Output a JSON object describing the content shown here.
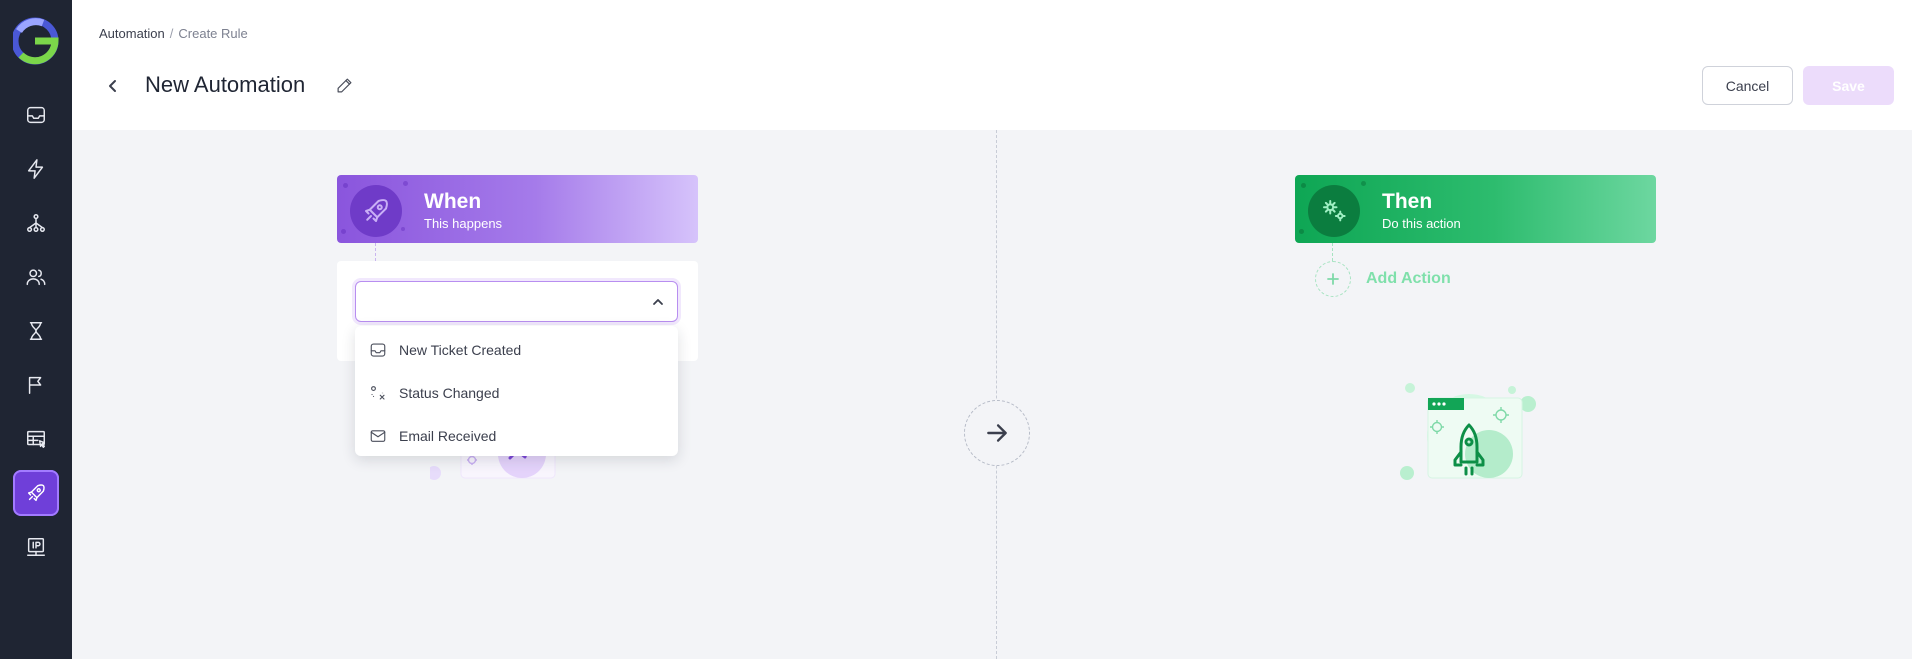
{
  "sidebar": {
    "logo_icon": "brand-logo-icon",
    "items": [
      {
        "name": "inbox",
        "icon": "inbox-icon",
        "active": false
      },
      {
        "name": "lightning",
        "icon": "lightning-icon",
        "active": false
      },
      {
        "name": "hierarchy",
        "icon": "hierarchy-icon",
        "active": false
      },
      {
        "name": "users",
        "icon": "users-icon",
        "active": false
      },
      {
        "name": "hourglass",
        "icon": "hourglass-icon",
        "active": false
      },
      {
        "name": "flag",
        "icon": "flag-icon",
        "active": false
      },
      {
        "name": "table-select",
        "icon": "table-select-icon",
        "active": false
      },
      {
        "name": "automation",
        "icon": "rocket-icon",
        "active": true
      },
      {
        "name": "ip-monitor",
        "icon": "ip-monitor-icon",
        "active": false
      }
    ],
    "active_color": "#6f3fd9"
  },
  "header": {
    "breadcrumb": {
      "root": "Automation",
      "separator": "/",
      "current": "Create Rule"
    },
    "title": "New Automation",
    "cancel_label": "Cancel",
    "save_label": "Save"
  },
  "when_block": {
    "title": "When",
    "subtitle": "This happens",
    "color": "#8a55dd",
    "trigger_select": {
      "value": "",
      "expanded": true
    },
    "options": [
      {
        "label": "New Ticket Created",
        "icon": "inbox-icon"
      },
      {
        "label": "Status Changed",
        "icon": "status-change-icon"
      },
      {
        "label": "Email Received",
        "icon": "envelope-icon"
      }
    ]
  },
  "then_block": {
    "title": "Then",
    "subtitle": "Do this action",
    "color": "#0ea654",
    "add_action_label": "Add Action"
  }
}
